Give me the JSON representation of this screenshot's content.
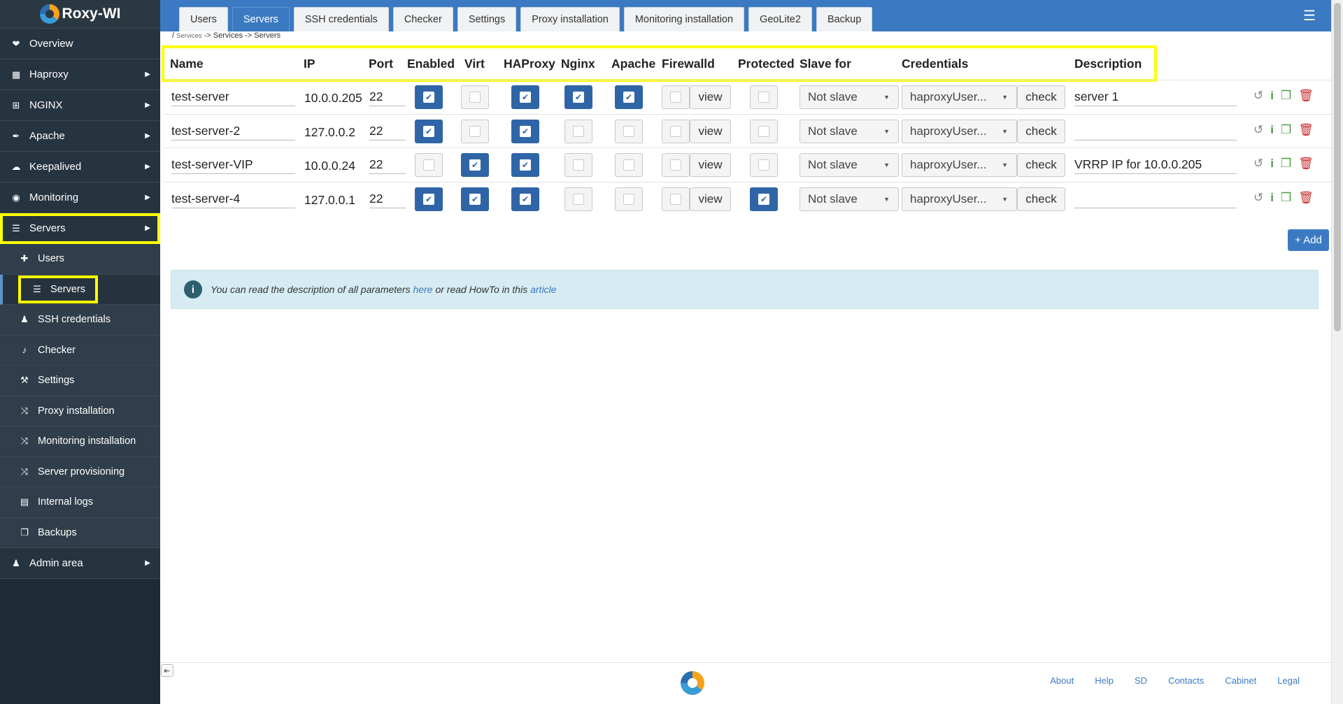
{
  "brand": {
    "name": "Roxy-WI"
  },
  "sidebar": {
    "items": [
      {
        "label": "Overview",
        "icon": "heartbeat-icon",
        "arrow": false
      },
      {
        "label": "Haproxy",
        "icon": "network-icon",
        "arrow": true
      },
      {
        "label": "NGINX",
        "icon": "sitemap-icon",
        "arrow": true
      },
      {
        "label": "Apache",
        "icon": "feather-icon",
        "arrow": true
      },
      {
        "label": "Keepalived",
        "icon": "cloud-icon",
        "arrow": true
      },
      {
        "label": "Monitoring",
        "icon": "eye-icon",
        "arrow": true
      },
      {
        "label": "Servers",
        "icon": "server-icon",
        "arrow": true
      }
    ],
    "subitems": [
      {
        "label": "Users",
        "icon": "user-plus-icon"
      },
      {
        "label": "Servers",
        "icon": "server-icon"
      },
      {
        "label": "SSH credentials",
        "icon": "user-secret-icon"
      },
      {
        "label": "Checker",
        "icon": "bell-icon"
      },
      {
        "label": "Settings",
        "icon": "wrench-icon"
      },
      {
        "label": "Proxy installation",
        "icon": "shuffle-icon"
      },
      {
        "label": "Monitoring installation",
        "icon": "shuffle-icon"
      },
      {
        "label": "Server provisioning",
        "icon": "shuffle-icon"
      },
      {
        "label": "Internal logs",
        "icon": "book-icon"
      },
      {
        "label": "Backups",
        "icon": "copy-icon"
      }
    ],
    "admin": {
      "label": "Admin area",
      "icon": "user-secret-icon"
    }
  },
  "tabs": [
    "Users",
    "Servers",
    "SSH credentials",
    "Checker",
    "Settings",
    "Proxy installation",
    "Monitoring installation",
    "GeoLite2",
    "Backup"
  ],
  "active_tab": "Servers",
  "breadcrumb": {
    "root": "/",
    "first": "Services",
    "sep1": "->",
    "second": "Services",
    "sep2": "->",
    "third": "Servers"
  },
  "table": {
    "headers": {
      "name": "Name",
      "ip": "IP",
      "port": "Port",
      "enabled": "Enabled",
      "virt": "Virt",
      "haproxy": "HAProxy",
      "nginx": "Nginx",
      "apache": "Apache",
      "firewalld": "Firewalld",
      "protected": "Protected",
      "slave_for": "Slave for",
      "credentials": "Credentials",
      "description": "Description"
    },
    "rows": [
      {
        "name": "test-server",
        "ip": "10.0.0.205",
        "port": "22",
        "enabled": true,
        "virt": false,
        "haproxy": true,
        "nginx": true,
        "apache": true,
        "firewalld": false,
        "protected": false,
        "slave": "Not slave",
        "credentials": "haproxyUser...",
        "description": "server 1"
      },
      {
        "name": "test-server-2",
        "ip": "127.0.0.2",
        "port": "22",
        "enabled": true,
        "virt": false,
        "haproxy": true,
        "nginx": false,
        "apache": false,
        "firewalld": false,
        "protected": false,
        "slave": "Not slave",
        "credentials": "haproxyUser...",
        "description": ""
      },
      {
        "name": "test-server-VIP",
        "ip": "10.0.0.24",
        "port": "22",
        "enabled": false,
        "virt": true,
        "haproxy": true,
        "nginx": false,
        "apache": false,
        "firewalld": false,
        "protected": false,
        "slave": "Not slave",
        "credentials": "haproxyUser...",
        "description": "VRRP IP for 10.0.0.205"
      },
      {
        "name": "test-server-4",
        "ip": "127.0.0.1",
        "port": "22",
        "enabled": true,
        "virt": true,
        "haproxy": true,
        "nginx": false,
        "apache": false,
        "firewalld": false,
        "protected": true,
        "slave": "Not slave",
        "credentials": "haproxyUser...",
        "description": ""
      }
    ],
    "view_label": "view",
    "check_label": "check"
  },
  "add_button": "+ Add",
  "alert": {
    "pre": "You can read the description of all parameters",
    "link1": "here",
    "mid": "or read HowTo in this",
    "link2": "article"
  },
  "footer": {
    "links": [
      "About",
      "Help",
      "SD",
      "Contacts",
      "Cabinet",
      "Legal"
    ]
  },
  "colors": {
    "accent": "#3b7ac2",
    "sidebar": "#1f2b34",
    "highlight": "#ffff00",
    "checked": "#2f65a6"
  }
}
